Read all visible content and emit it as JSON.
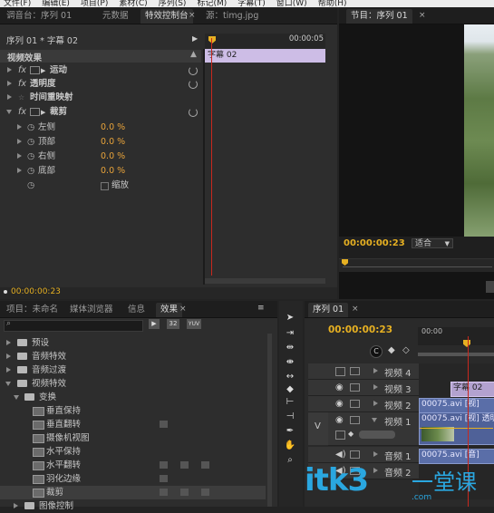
{
  "menu": [
    "文件(F)",
    "编辑(E)",
    "项目(P)",
    "素材(C)",
    "序列(S)",
    "标记(M)",
    "字幕(T)",
    "窗口(W)",
    "帮助(H)"
  ],
  "top_tabs": {
    "left": [
      "调音台：序列 01",
      "元数据",
      "特效控制台",
      "源：timg.jpg"
    ],
    "right": "节目：序列 01"
  },
  "effect_controls": {
    "sequence_label": "序列 01 * 字幕 02",
    "timecode_ruler": "00:00:05",
    "section_title": "视频效果",
    "clip_name": "字幕 02",
    "effects": [
      {
        "fx": "fx",
        "name": "运动"
      },
      {
        "fx": "fx",
        "name": "透明度"
      },
      {
        "fx": "",
        "name": "时间重映射"
      },
      {
        "fx": "fx",
        "name": "裁剪"
      }
    ],
    "crop_params": [
      {
        "name": "左侧",
        "value": "0.0 %"
      },
      {
        "name": "顶部",
        "value": "0.0 %"
      },
      {
        "name": "右侧",
        "value": "0.0 %"
      },
      {
        "name": "底部",
        "value": "0.0 %"
      }
    ],
    "zoom_label": "缩放",
    "bottom_timecode": "00:00:00:23"
  },
  "program": {
    "timecode": "00:00:00:23",
    "fit": "适合"
  },
  "project_tabs": [
    "项目：未命名",
    "媒体浏览器",
    "信息",
    "效果"
  ],
  "effects_tree": [
    {
      "level": 0,
      "type": "folder",
      "label": "预设"
    },
    {
      "level": 0,
      "type": "folder",
      "label": "音频特效"
    },
    {
      "level": 0,
      "type": "folder",
      "label": "音频过渡"
    },
    {
      "level": 0,
      "type": "folder",
      "label": "视频特效",
      "open": true
    },
    {
      "level": 1,
      "type": "folder",
      "label": "变换",
      "open": true
    },
    {
      "level": 2,
      "type": "fx",
      "label": "垂直保持"
    },
    {
      "level": 2,
      "type": "fx",
      "label": "垂直翻转"
    },
    {
      "level": 2,
      "type": "fx",
      "label": "摄像机视图"
    },
    {
      "level": 2,
      "type": "fx",
      "label": "水平保持"
    },
    {
      "level": 2,
      "type": "fx",
      "label": "水平翻转"
    },
    {
      "level": 2,
      "type": "fx",
      "label": "羽化边缘"
    },
    {
      "level": 2,
      "type": "fx",
      "label": "裁剪",
      "selected": true
    },
    {
      "level": 1,
      "type": "folder",
      "label": "图像控制"
    }
  ],
  "effect_badges": [
    "32",
    "YUV"
  ],
  "timeline": {
    "tab": "序列 01",
    "timecode": "00:00:00:23",
    "ruler_label": "00:00",
    "tracks": [
      {
        "name": "视频 4"
      },
      {
        "name": "视频 3",
        "clip": "字幕 02"
      },
      {
        "name": "视频 2",
        "clip": "00075.avi [视]"
      },
      {
        "name": "视频 1",
        "clip": "00075.avi [视] 透明度:透"
      },
      {
        "name": "音频 1",
        "clip": "00075.avi [音]"
      },
      {
        "name": "音频 2"
      }
    ],
    "v_label": "V"
  },
  "watermark": {
    "latin": "itk3",
    "cjk": "一堂课",
    "url": ".com"
  }
}
